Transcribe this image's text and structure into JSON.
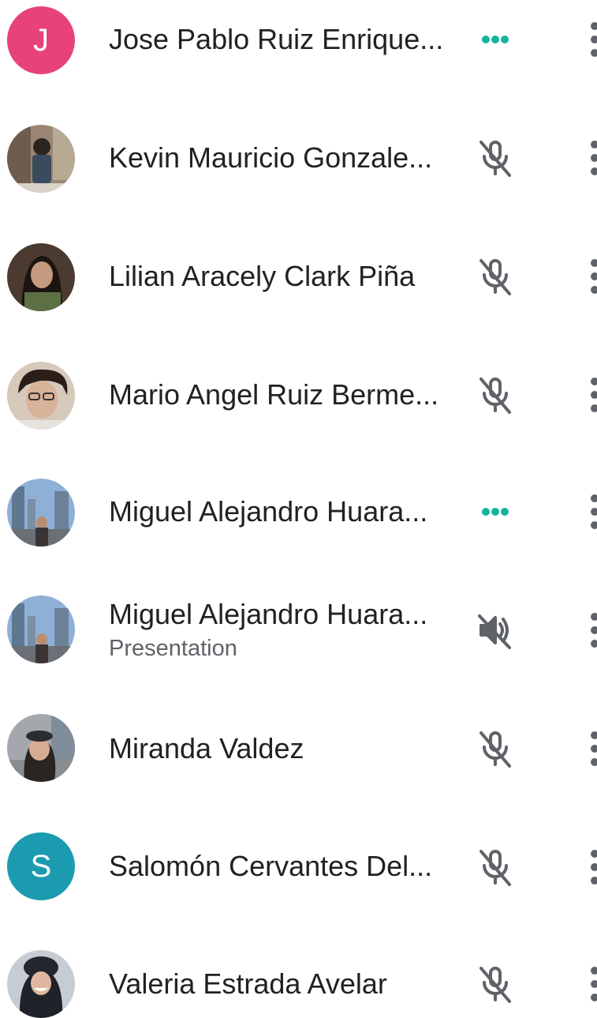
{
  "participants": [
    {
      "name": "Jose Pablo Ruiz Enrique...",
      "avatar": {
        "type": "letter",
        "letter": "J",
        "color": "#e8427a"
      },
      "status_icon": "speaking-dots-icon"
    },
    {
      "name": "Kevin Mauricio Gonzale...",
      "avatar": {
        "type": "photo",
        "color": "#7a6a5a"
      },
      "status_icon": "mic-off-icon"
    },
    {
      "name": "Lilian Aracely Clark Piña",
      "avatar": {
        "type": "photo",
        "color": "#3f4a3a"
      },
      "status_icon": "mic-off-icon"
    },
    {
      "name": "Mario Angel Ruiz Berme...",
      "avatar": {
        "type": "photo",
        "color": "#8a7060"
      },
      "status_icon": "mic-off-icon"
    },
    {
      "name": "Miguel Alejandro Huara...",
      "avatar": {
        "type": "photo",
        "color": "#6d8fb8"
      },
      "status_icon": "speaking-dots-icon"
    },
    {
      "name": "Miguel Alejandro Huara...",
      "subtitle": "Presentation",
      "avatar": {
        "type": "photo",
        "color": "#6d8fb8"
      },
      "status_icon": "volume-off-icon"
    },
    {
      "name": "Miranda Valdez",
      "avatar": {
        "type": "photo",
        "color": "#8d8f96"
      },
      "status_icon": "mic-off-icon"
    },
    {
      "name": "Salomón Cervantes Del...",
      "avatar": {
        "type": "letter",
        "letter": "S",
        "color": "#1a9bb0"
      },
      "status_icon": "mic-off-icon"
    },
    {
      "name": "Valeria Estrada Avelar",
      "avatar": {
        "type": "photo",
        "color": "#5b6f86"
      },
      "status_icon": "mic-off-icon"
    }
  ],
  "colors": {
    "speaking_dots": "#13b4a0",
    "icon_gray": "#5f6368",
    "text_primary": "#202124",
    "text_secondary": "#5f6368"
  }
}
